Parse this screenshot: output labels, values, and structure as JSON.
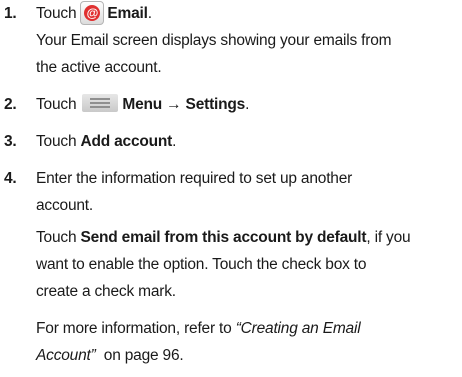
{
  "steps": [
    {
      "num": "1.",
      "touch": "Touch",
      "label": "Email",
      "period": ".",
      "desc_lines": [
        "Your Email screen displays showing your emails from",
        "the active account."
      ]
    },
    {
      "num": "2.",
      "touch": "Touch",
      "label": "Menu → Settings",
      "period": "."
    },
    {
      "num": "3.",
      "touch": "Touch",
      "label": "Add account",
      "period": "."
    },
    {
      "num": "4.",
      "lines": [
        "Enter the information required to set up another",
        "account."
      ],
      "p2_touch": "Touch",
      "p2_bold": "Send email from this account by default",
      "p2_rest": ", if you",
      "p2_lines": [
        "want to enable the option. Touch the check box to",
        "create a check mark."
      ],
      "p3_pre": "For more information, refer to",
      "p3_link1": "“Creating an Email",
      "p3_link2": "Account”",
      "p3_post": "on page 96."
    }
  ],
  "icons": {
    "email": "email-app-icon",
    "email_glyph": "@",
    "menu": "menu-key-icon"
  },
  "colors": {
    "email_icon_accent": "#e03030"
  }
}
